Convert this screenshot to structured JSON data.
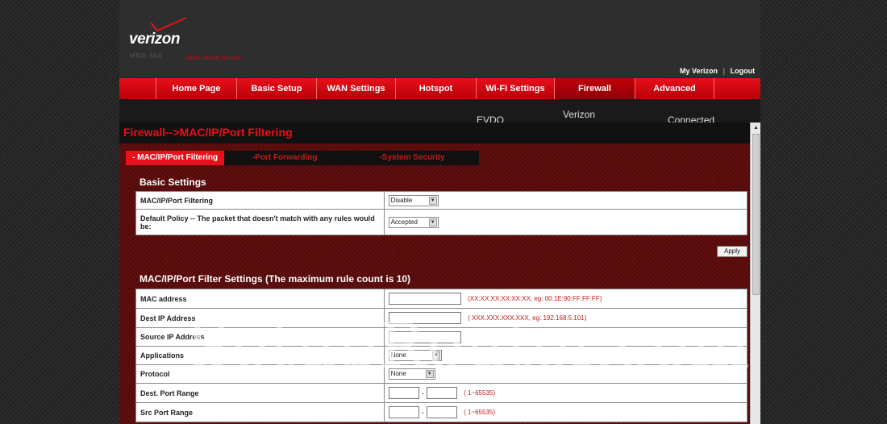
{
  "brand": {
    "name": "verizon",
    "model": "MBR-500",
    "sub": "Global Mobile Hotspot"
  },
  "top_links": {
    "my_verizon": "My Verizon",
    "separator": "|",
    "logout": "Logout"
  },
  "nav": [
    "Home Page",
    "Basic Setup",
    "WAN Settings",
    "Hotspot",
    "Wi-Fi Settings",
    "Firewall",
    "Advanced"
  ],
  "status": {
    "network": "EVDO",
    "carrier": "Verizon",
    "connection": "Connected"
  },
  "page_title": "Firewall-->MAC/IP/Port Filtering",
  "subtabs": [
    "- MAC/IP/Port Filtering",
    "-Port Forwarding",
    "-System Security"
  ],
  "basic": {
    "title": "Basic Settings",
    "rows": [
      {
        "label": "MAC/IP/Port Filtering",
        "value": "Disable"
      },
      {
        "label": "Default Policy -- The packet that doesn't match with any rules would be:",
        "value": "Accepted"
      }
    ],
    "apply_label": "Apply"
  },
  "filter": {
    "title": "MAC/IP/Port Filter Settings (The maximum rule count is 10)",
    "mac_label": "MAC address",
    "mac_hint": "(XX:XX:XX:XX:XX:XX, eg: 00:1E:90:FF:FF:FF)",
    "dest_ip_label": "Dest IP Address",
    "dest_ip_hint": "( XXX.XXX.XXX.XXX, eg: 192.168.5.101)",
    "src_ip_label": "Source IP Address",
    "app_label": "Applications",
    "app_value": "None",
    "proto_label": "Protocol",
    "proto_value": "None",
    "dest_port_label": "Dest. Port Range",
    "dest_port_hint": "( 1~65535)",
    "src_port_label": "Src Port Range",
    "src_port_hint": "( 1~65535)"
  },
  "watermark": "SetupRouter.com"
}
